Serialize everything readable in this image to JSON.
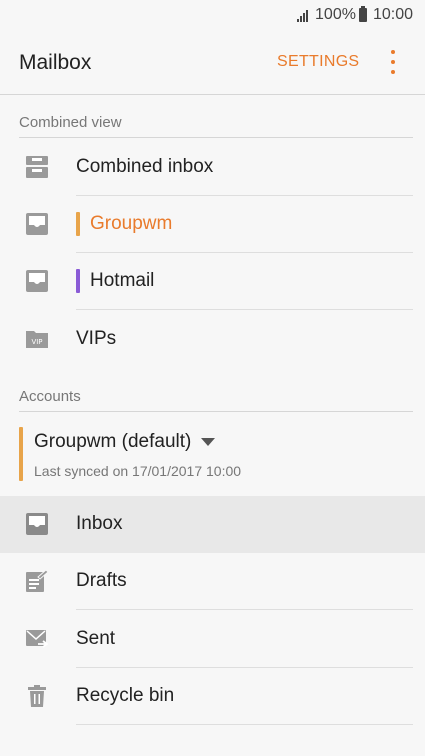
{
  "status_bar": {
    "battery": "100%",
    "time": "10:00"
  },
  "app_bar": {
    "title": "Mailbox",
    "settings_label": "SETTINGS"
  },
  "combined_view": {
    "header": "Combined view",
    "items": [
      {
        "label": "Combined inbox",
        "icon": "combined-inbox-icon"
      },
      {
        "label": "Groupwm",
        "icon": "inbox-tray-icon",
        "color": "#e8a44a"
      },
      {
        "label": "Hotmail",
        "icon": "inbox-tray-icon",
        "color": "#8a5bd6"
      },
      {
        "label": "VIPs",
        "icon": "vip-folder-icon",
        "icon_text": "VIP"
      }
    ]
  },
  "accounts": {
    "header": "Accounts",
    "account_name": "Groupwm (default)",
    "account_color": "#e8a44a",
    "last_synced": "Last synced on 17/01/2017  10:00",
    "folders": [
      {
        "label": "Inbox",
        "icon": "inbox-tray-icon",
        "active": true
      },
      {
        "label": "Drafts",
        "icon": "drafts-icon"
      },
      {
        "label": "Sent",
        "icon": "sent-icon"
      },
      {
        "label": "Recycle bin",
        "icon": "trash-icon"
      }
    ]
  },
  "colors": {
    "accent": "#e97b2c",
    "active_row": "#e8e8e8"
  }
}
